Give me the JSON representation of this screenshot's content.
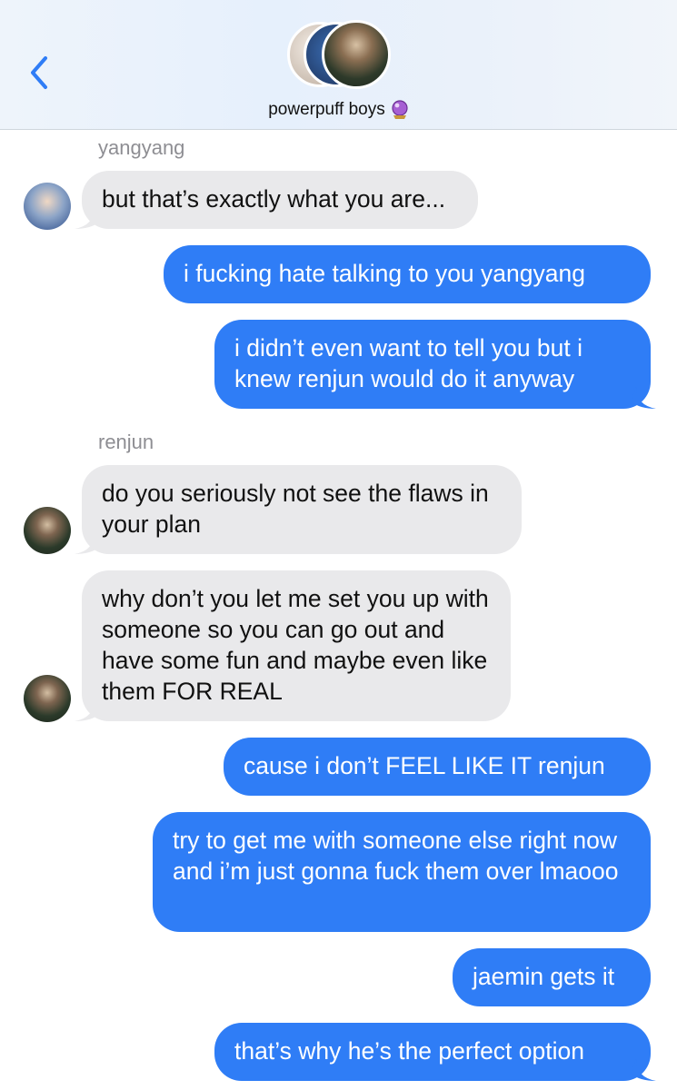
{
  "header": {
    "group_name": "powerpuff boys",
    "back_icon": "chevron-left-icon",
    "emoji_icon": "crystal-ball-icon"
  },
  "colors": {
    "outgoing": "#2f7df6",
    "incoming": "#e9e9eb",
    "accent": "#2f7df6"
  },
  "messages": [
    {
      "sender": "yangyang"
    },
    {
      "text": "but that’s exactly what you are..."
    },
    {
      "text": "i fucking hate talking to you yangyang"
    },
    {
      "text": "i didn’t even want to tell you but i knew renjun would do it anyway"
    },
    {
      "sender": "renjun"
    },
    {
      "text": "do you seriously not see the flaws in your plan"
    },
    {
      "text": "why don’t you let me set you up with someone so you can go out and have some fun and maybe even like them FOR REAL"
    },
    {
      "text": "cause i don’t FEEL LIKE IT renjun"
    },
    {
      "text": "try to get me with someone else right now and i’m just gonna fuck them over lmaooo"
    },
    {
      "text": "jaemin gets it"
    },
    {
      "text": "that’s why he’s the perfect option"
    }
  ]
}
